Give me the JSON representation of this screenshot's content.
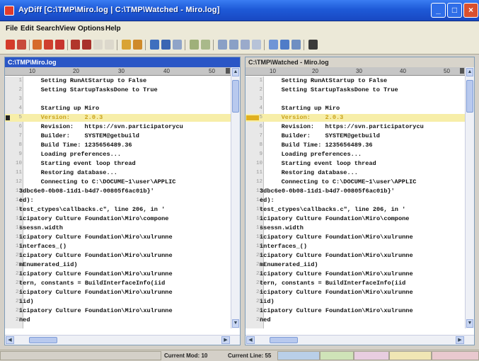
{
  "window": {
    "title": "AyDiff  [C:\\TMP\\Miro.log | C:\\TMP\\Watched - Miro.log]",
    "minimize_label": "_",
    "maximize_label": "□",
    "close_label": "×"
  },
  "menu": {
    "items": [
      "File",
      "Edit",
      "Search",
      "View",
      "Options",
      "Help"
    ]
  },
  "colors": {
    "title_bar": "#1e5ad8",
    "left_pane_title": "#2a56c6",
    "highlight_line": "#f7eea8",
    "highlight_text": "#c9a21a"
  },
  "left_pane": {
    "title": "C:\\TMP\\Miro.log",
    "ruler": [
      "10",
      "20",
      "30",
      "40",
      "50"
    ]
  },
  "right_pane": {
    "title": "C:\\TMP\\Watched - Miro.log",
    "ruler": [
      "10",
      "20",
      "30",
      "40",
      "50"
    ]
  },
  "lines": [
    {
      "num": "1",
      "text": "    Setting RunAtStartup to False",
      "wrap": false
    },
    {
      "num": "2",
      "text": "    Setting StartupTasksDone to True",
      "wrap": false
    },
    {
      "num": "3",
      "text": "",
      "wrap": false
    },
    {
      "num": "4",
      "text": "    Starting up Miro",
      "wrap": false
    },
    {
      "num": "5",
      "text": "    Version:    2.0.3",
      "wrap": false,
      "highlight": true
    },
    {
      "num": "6",
      "text": "    Revision:   https://svn.participatorycu",
      "wrap": false
    },
    {
      "num": "7",
      "text": "    Builder:    SYSTEM@getbuild",
      "wrap": false
    },
    {
      "num": "8",
      "text": "    Build Time: 1235656489.36",
      "wrap": false
    },
    {
      "num": "9",
      "text": "    Loading preferences...",
      "wrap": false
    },
    {
      "num": "10",
      "text": "    Starting event loop thread",
      "wrap": false
    },
    {
      "num": "11",
      "text": "    Restoring database...",
      "wrap": false
    },
    {
      "num": "12",
      "text": "    Connecting to C:\\DOCUME~1\\user\\APPLIC",
      "wrap": false
    },
    {
      "num": "13",
      "text": "3dbc6e0-0b08-11d1-b4d7-00805f6ac01b}'",
      "wrap": true
    },
    {
      "num": "14",
      "text": "ed):",
      "wrap": true
    },
    {
      "num": "15",
      "text": "test_ctypes\\callbacks.c\", line 206, in '",
      "wrap": true
    },
    {
      "num": "16",
      "text": "icipatory Culture Foundation\\Miro\\compone",
      "wrap": true
    },
    {
      "num": "17",
      "text": "ssessn.width",
      "wrap": true
    },
    {
      "num": "18",
      "text": "icipatory Culture Foundation\\Miro\\xulrunne",
      "wrap": true
    },
    {
      "num": "19",
      "text": "interfaces_()",
      "wrap": true
    },
    {
      "num": "20",
      "text": "icipatory Culture Foundation\\Miro\\xulrunne",
      "wrap": true
    },
    {
      "num": "21",
      "text": "mEnumerated_iid)",
      "wrap": true
    },
    {
      "num": "22",
      "text": "icipatory Culture Foundation\\Miro\\xulrunne",
      "wrap": true
    },
    {
      "num": "23",
      "text": "tern, constants = BuildInterfaceInfo(iid",
      "wrap": true
    },
    {
      "num": "24",
      "text": "icipatory Culture Foundation\\Miro\\xulrunne",
      "wrap": true
    },
    {
      "num": "25",
      "text": "iid)",
      "wrap": true
    },
    {
      "num": "26",
      "text": "icipatory Culture Foundation\\Miro\\xulrunne",
      "wrap": true
    },
    {
      "num": "27",
      "text": "ned",
      "wrap": true
    }
  ],
  "status": {
    "text1": "Current Mod: 10",
    "text2": "Current Line: 55"
  }
}
